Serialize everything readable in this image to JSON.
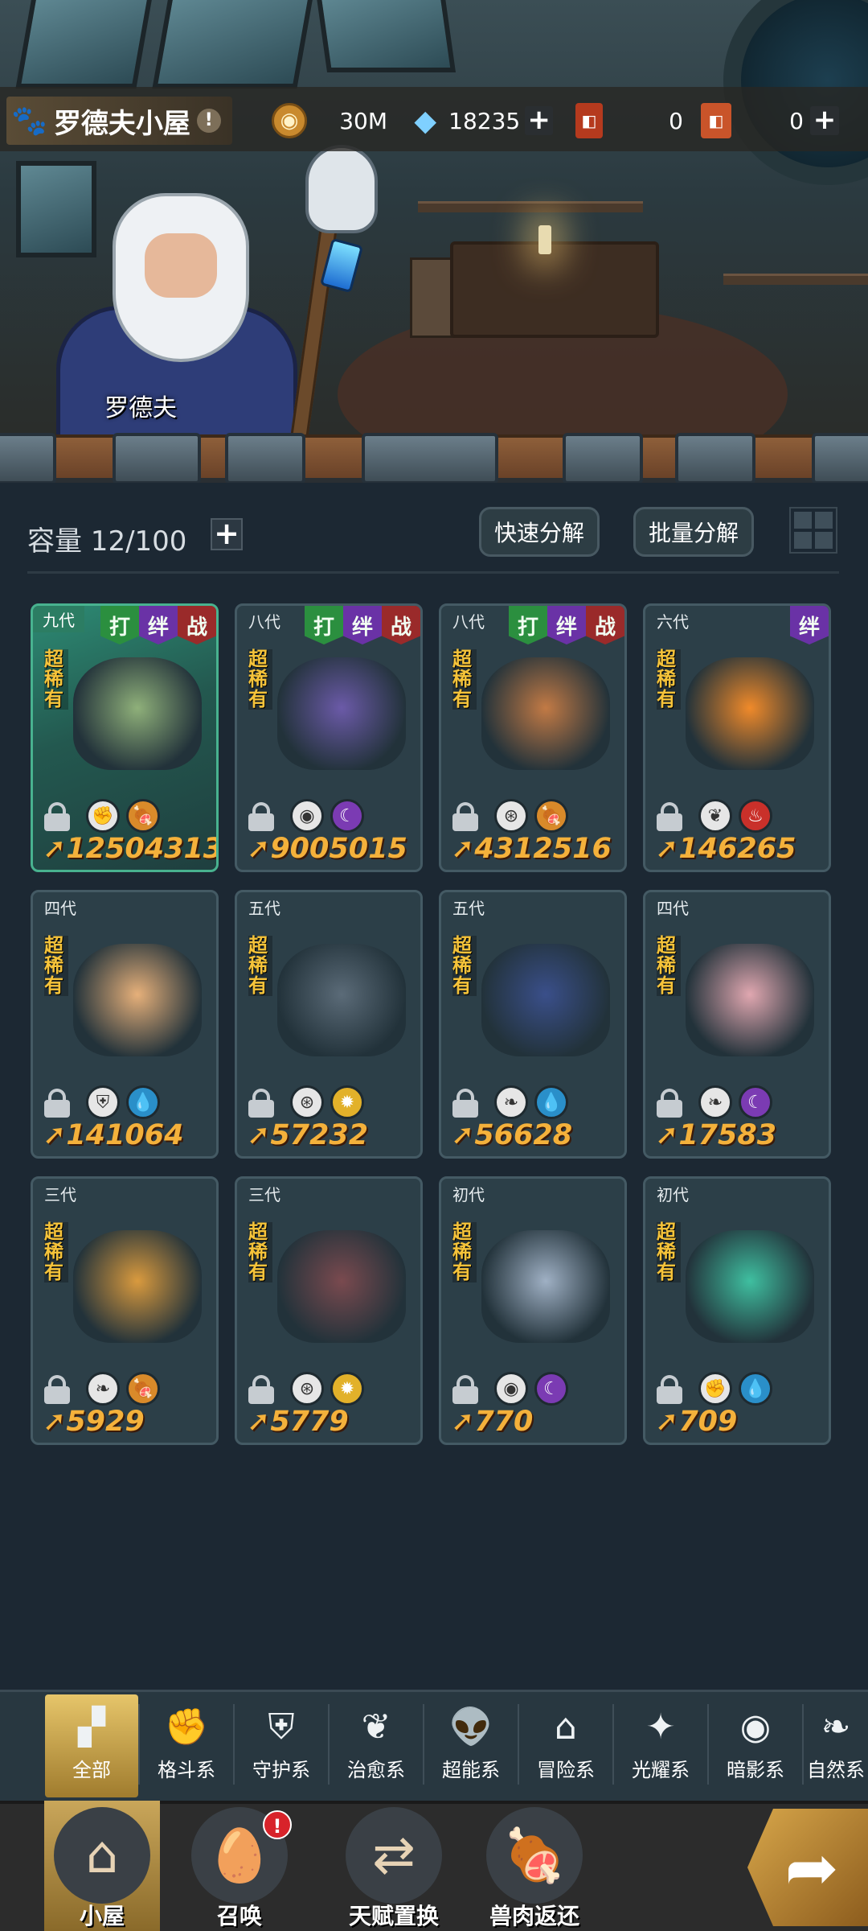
{
  "header": {
    "location_title": "罗德夫小屋",
    "npc_name": "罗德夫",
    "resources": [
      {
        "icon": "coin-icon",
        "value": "30M",
        "has_plus": false
      },
      {
        "icon": "diamond-icon",
        "value": "18235",
        "has_plus": true
      },
      {
        "icon": "ticket-red-icon",
        "value": "0",
        "has_plus": false
      },
      {
        "icon": "ticket-orange-icon",
        "value": "0",
        "has_plus": true
      }
    ]
  },
  "storage": {
    "capacity_label": "容量 12/100",
    "quick_decompose": "快速分解",
    "batch_decompose": "批量分解"
  },
  "cards": [
    {
      "gen": "九代",
      "tags": [
        "打",
        "绊",
        "战"
      ],
      "rarity": "超稀有",
      "power": "12504313",
      "elements": [
        "fist-icon",
        "meat-icon"
      ],
      "art": "#8fb07a",
      "selected": true
    },
    {
      "gen": "八代",
      "tags": [
        "打",
        "绊",
        "战"
      ],
      "rarity": "超稀有",
      "power": "9005015",
      "elements": [
        "eye-icon",
        "moon-icon"
      ],
      "art": "#6b5aa8",
      "selected": false
    },
    {
      "gen": "八代",
      "tags": [
        "打",
        "绊",
        "战"
      ],
      "rarity": "超稀有",
      "power": "4312516",
      "elements": [
        "guard-icon",
        "meat-icon"
      ],
      "art": "#c27a45",
      "selected": false
    },
    {
      "gen": "六代",
      "tags": [
        "绊"
      ],
      "rarity": "超稀有",
      "power": "146265",
      "elements": [
        "sprout-icon",
        "fire-icon"
      ],
      "art": "#f08a2a",
      "selected": false
    },
    {
      "gen": "四代",
      "tags": [],
      "rarity": "超稀有",
      "power": "141064",
      "elements": [
        "shield-icon",
        "water-icon"
      ],
      "art": "#e6b07a",
      "selected": false
    },
    {
      "gen": "五代",
      "tags": [],
      "rarity": "超稀有",
      "power": "57232",
      "elements": [
        "guard-icon",
        "sun-icon"
      ],
      "art": "#5b6b78",
      "selected": false
    },
    {
      "gen": "五代",
      "tags": [],
      "rarity": "超稀有",
      "power": "56628",
      "elements": [
        "leaf-icon",
        "water-icon"
      ],
      "art": "#3a4f8a",
      "selected": false
    },
    {
      "gen": "四代",
      "tags": [],
      "rarity": "超稀有",
      "power": "17583",
      "elements": [
        "leaf-icon",
        "moon-icon"
      ],
      "art": "#e0a7b0",
      "selected": false
    },
    {
      "gen": "三代",
      "tags": [],
      "rarity": "超稀有",
      "power": "5929",
      "elements": [
        "leaf-icon",
        "meat-icon"
      ],
      "art": "#d99a3e",
      "selected": false
    },
    {
      "gen": "三代",
      "tags": [],
      "rarity": "超稀有",
      "power": "5779",
      "elements": [
        "guard-icon",
        "sun-icon"
      ],
      "art": "#7a4a4f",
      "selected": false
    },
    {
      "gen": "初代",
      "tags": [],
      "rarity": "超稀有",
      "power": "770",
      "elements": [
        "eye-icon",
        "moon-icon"
      ],
      "art": "#9fb0c4",
      "selected": false
    },
    {
      "gen": "初代",
      "tags": [],
      "rarity": "超稀有",
      "power": "709",
      "elements": [
        "fist-icon",
        "water-icon"
      ],
      "art": "#3fbfa0",
      "selected": false
    }
  ],
  "filters": [
    {
      "label": "全部",
      "icon": "grid-icon",
      "active": true
    },
    {
      "label": "格斗系",
      "icon": "fist-icon",
      "active": false
    },
    {
      "label": "守护系",
      "icon": "shield-icon",
      "active": false
    },
    {
      "label": "治愈系",
      "icon": "sprout-icon",
      "active": false
    },
    {
      "label": "超能系",
      "icon": "alien-icon",
      "active": false
    },
    {
      "label": "冒险系",
      "icon": "lantern-icon",
      "active": false
    },
    {
      "label": "光耀系",
      "icon": "sparkle-icon",
      "active": false
    },
    {
      "label": "暗影系",
      "icon": "eye-icon",
      "active": false
    },
    {
      "label": "自然系",
      "icon": "leaf-icon",
      "active": false
    }
  ],
  "nav": [
    {
      "label": "小屋",
      "icon": "house-icon",
      "active": true,
      "badge": ""
    },
    {
      "label": "召唤",
      "icon": "egg-icon",
      "active": false,
      "badge": "!"
    },
    {
      "label": "天赋置换",
      "icon": "swap-icon",
      "active": false,
      "badge": ""
    },
    {
      "label": "兽肉返还",
      "icon": "meat-icon",
      "active": false,
      "badge": ""
    }
  ],
  "colors": {
    "power": "#f4b13b",
    "rarity": "#f5c33a",
    "selected_card": "#2d8b74",
    "active_tab": "#d8b152"
  }
}
